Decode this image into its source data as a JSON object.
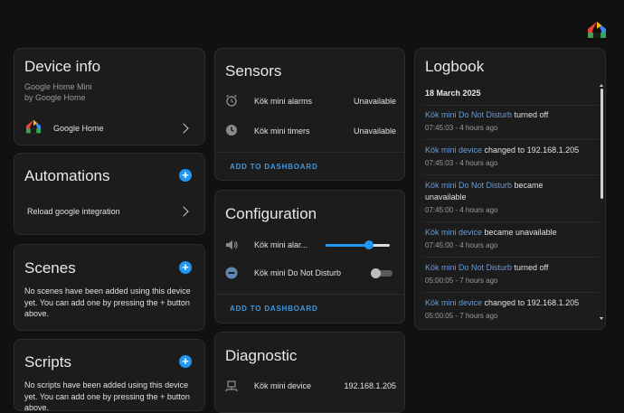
{
  "device_info": {
    "title": "Device info",
    "model": "Google Home Mini",
    "manufacturer": "by Google Home",
    "integration": "Google Home"
  },
  "automations": {
    "title": "Automations",
    "items": [
      "Reload google integration"
    ]
  },
  "scenes": {
    "title": "Scenes",
    "empty_text": "No scenes have been added using this device yet. You can add one by pressing the + button above."
  },
  "scripts": {
    "title": "Scripts",
    "empty_text": "No scripts have been added using this device yet. You can add one by pressing the + button above."
  },
  "sensors": {
    "title": "Sensors",
    "rows": [
      {
        "label": "Kök mini alarms",
        "value": "Unavailable"
      },
      {
        "label": "Kök mini timers",
        "value": "Unavailable"
      }
    ],
    "add_label": "ADD TO DASHBOARD"
  },
  "configuration": {
    "title": "Configuration",
    "volume_label": "Kök mini alar...",
    "volume_level": 0.68,
    "dnd_label": "Kök mini Do Not Disturb",
    "dnd_on": false,
    "add_label": "ADD TO DASHBOARD"
  },
  "diagnostic": {
    "title": "Diagnostic",
    "rows": [
      {
        "label": "Kök mini device",
        "value": "192.168.1.205"
      }
    ]
  },
  "logbook": {
    "title": "Logbook",
    "date": "18 March 2025",
    "entries": [
      {
        "who": "Kök mini Do Not Disturb",
        "what": " turned off",
        "time": "07:45:03 - 4 hours ago"
      },
      {
        "who": "Kök mini device",
        "what": " changed to 192.168.1.205",
        "time": "07:45:03 - 4 hours ago"
      },
      {
        "who": "Kök mini Do Not Disturb",
        "what": " became unavailable",
        "time": "07:45:00 - 4 hours ago"
      },
      {
        "who": "Kök mini device",
        "what": " became unavailable",
        "time": "07:45:00 - 4 hours ago"
      },
      {
        "who": "Kök mini Do Not Disturb",
        "what": " turned off",
        "time": "05:00:05 - 7 hours ago"
      },
      {
        "who": "Kök mini device",
        "what": " changed to 192.168.1.205",
        "time": "05:00:05 - 7 hours ago"
      }
    ]
  },
  "colors": {
    "accent": "#2196f3",
    "background": "#111111",
    "card": "#1c1c1c"
  }
}
